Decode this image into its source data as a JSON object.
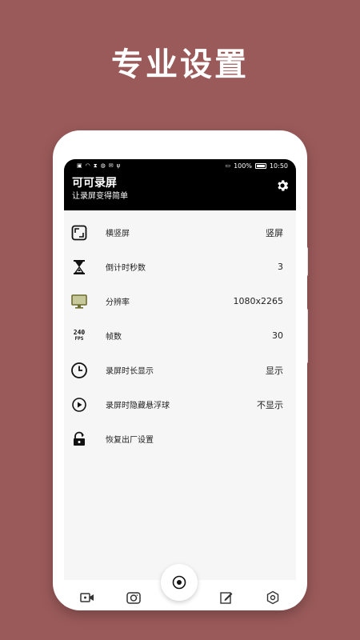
{
  "headline": "专业设置",
  "status_bar": {
    "battery_percent": "100%",
    "time": "10:50"
  },
  "app": {
    "title": "可可录屏",
    "subtitle": "让录屏变得简单"
  },
  "settings": [
    {
      "label": "横竖屏",
      "value": "竖屏",
      "icon": "screen-rotation-icon"
    },
    {
      "label": "倒计时秒数",
      "value": "3",
      "icon": "hourglass-icon"
    },
    {
      "label": "分辨率",
      "value": "1080x2265",
      "icon": "monitor-icon"
    },
    {
      "label": "帧数",
      "value": "30",
      "icon": "fps-icon",
      "icon_text_top": "240",
      "icon_text_bottom": "FPS"
    },
    {
      "label": "录屏时长显示",
      "value": "显示",
      "icon": "clock-icon"
    },
    {
      "label": "录屏时隐藏悬浮球",
      "value": "不显示",
      "icon": "play-circle-icon"
    },
    {
      "label": "恢复出厂设置",
      "value": "",
      "icon": "reset-icon"
    }
  ],
  "colors": {
    "background": "#9b5a5a",
    "appbar": "#000000",
    "screen": "#f6f6f6",
    "monitor_icon": "#7a7a3a"
  }
}
